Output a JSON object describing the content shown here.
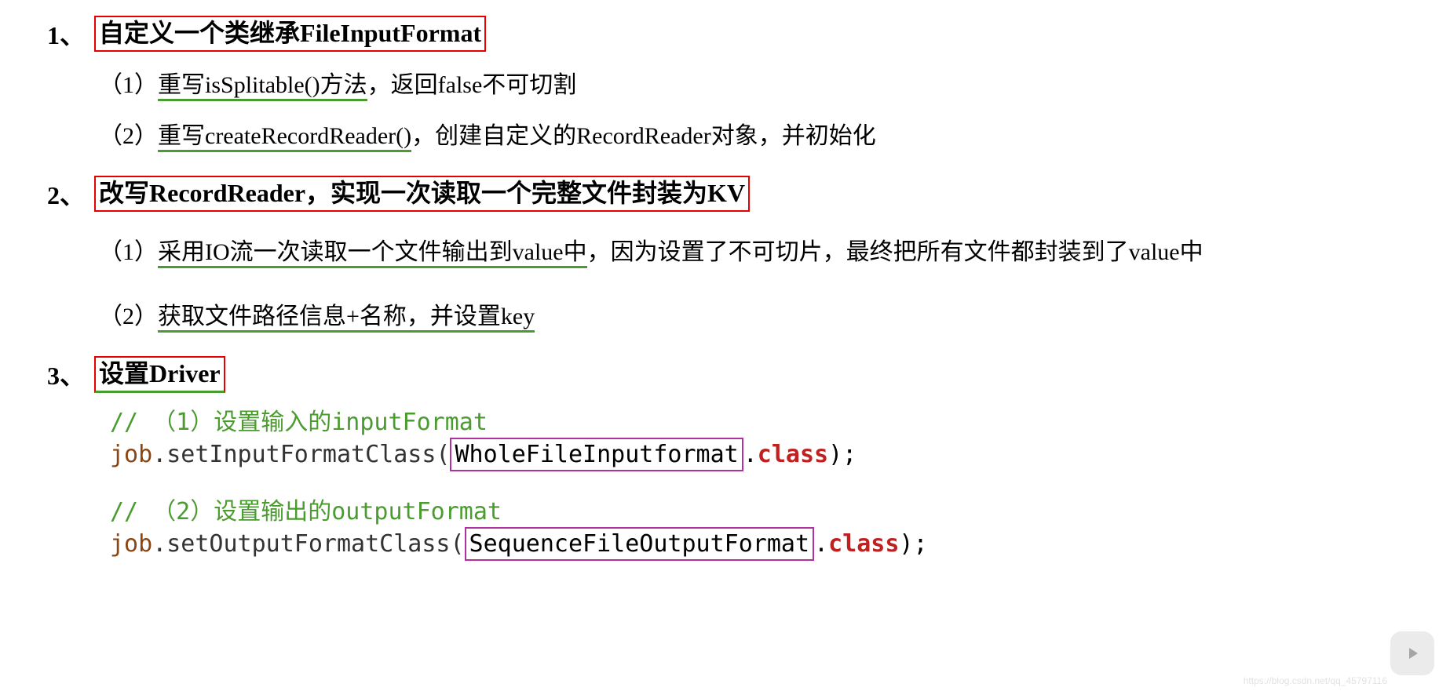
{
  "section1": {
    "num": "1、",
    "heading": "自定义一个类继承FileInputFormat",
    "item1_num": "（1）",
    "item1_underline": "重写isSplitable()方法",
    "item1_rest": "，返回false不可切割",
    "item2_num": "（2）",
    "item2_underline": "重写createRecordReader()",
    "item2_rest": "，创建自定义的RecordReader对象，并初始化"
  },
  "section2": {
    "num": "2、",
    "heading": "改写RecordReader，实现一次读取一个完整文件封装为KV",
    "item1_num": "（1）",
    "item1_underline": "采用IO流一次读取一个文件输出到value中",
    "item1_rest": "，因为设置了不可切片，最终把所有文件都封装到了value中",
    "item2_num": "（2）",
    "item2_underline": "获取文件路径信息+名称，并设置key "
  },
  "section3": {
    "num": "3、",
    "heading": "设置Driver",
    "code1_comment": "// （1）设置输入的inputFormat",
    "code1_obj": "job",
    "code1_method": ".setInputFormatClass(",
    "code1_boxed": "WholeFileInputformat",
    "code1_dot": ".",
    "code1_keyword": "class",
    "code1_end": ");",
    "code2_comment": "// （2）设置输出的outputFormat",
    "code2_obj": "job",
    "code2_method": ".setOutputFormatClass(",
    "code2_boxed": "SequenceFileOutputFormat",
    "code2_dot": ".",
    "code2_keyword": "class",
    "code2_end": ");"
  },
  "watermark": "https://blog.csdn.net/qq_45797116"
}
